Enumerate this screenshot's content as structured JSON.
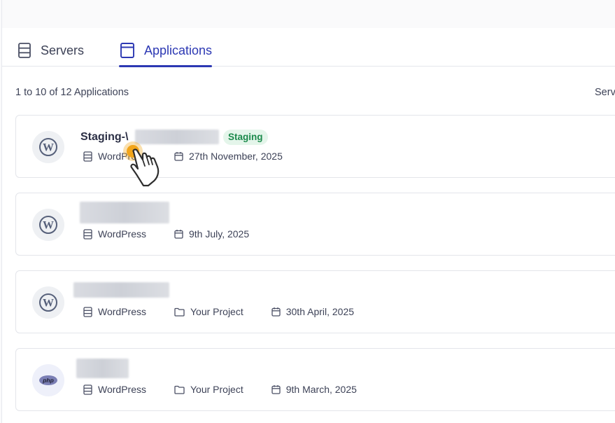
{
  "tabs": [
    {
      "label": "Servers",
      "active": false
    },
    {
      "label": "Applications",
      "active": true
    }
  ],
  "results_count": "1 to 10 of 12 Applications",
  "sort_label": "Serv",
  "apps": [
    {
      "name": "Staging-\\",
      "badge": "Staging",
      "type": "WordPress",
      "project": "",
      "date": "27th November, 2025",
      "logo": "wordpress-icon"
    },
    {
      "name": "",
      "badge": "",
      "type": "WordPress",
      "project": "",
      "date": "9th July, 2025",
      "logo": "wordpress-icon"
    },
    {
      "name": "",
      "badge": "",
      "type": "WordPress",
      "project": "Your Project",
      "date": "30th April, 2025",
      "logo": "wordpress-icon"
    },
    {
      "name": "",
      "badge": "",
      "type": "WordPress",
      "project": "Your Project",
      "date": "9th March, 2025",
      "logo": "php-icon"
    }
  ],
  "colors": {
    "accent": "#2c38b3",
    "staging_badge_bg": "#e4f5ea",
    "staging_badge_text": "#1c8a4c",
    "cursor_highlight": "#f2a51a"
  }
}
